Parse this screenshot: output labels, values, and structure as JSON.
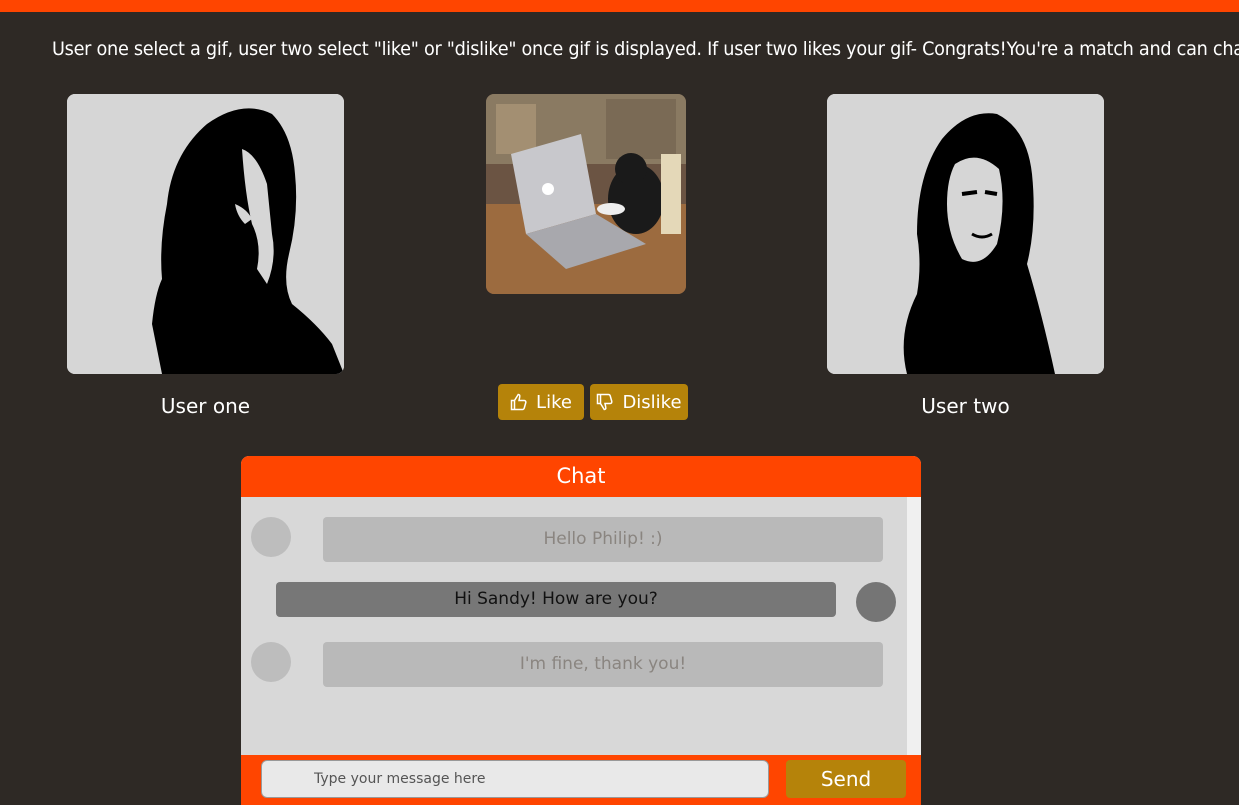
{
  "instructions": "User one select a gif, user two select \"like\" or \"dislike\" once gif is displayed. If user two likes your gif- Congrats!You're a match and can chat!",
  "users": {
    "one": {
      "label": "User one"
    },
    "two": {
      "label": "User two"
    }
  },
  "buttons": {
    "like": "Like",
    "dislike": "Dislike"
  },
  "chat": {
    "title": "Chat",
    "messages": [
      {
        "sender": "other",
        "text": "Hello Philip! :)"
      },
      {
        "sender": "me",
        "text": "Hi Sandy! How are you?"
      },
      {
        "sender": "other",
        "text": "I'm fine, thank you!"
      }
    ],
    "input_placeholder": "Type your message here",
    "send_label": "Send"
  },
  "colors": {
    "accent": "#ff4500",
    "button": "#b5830a",
    "background": "#2e2925"
  }
}
